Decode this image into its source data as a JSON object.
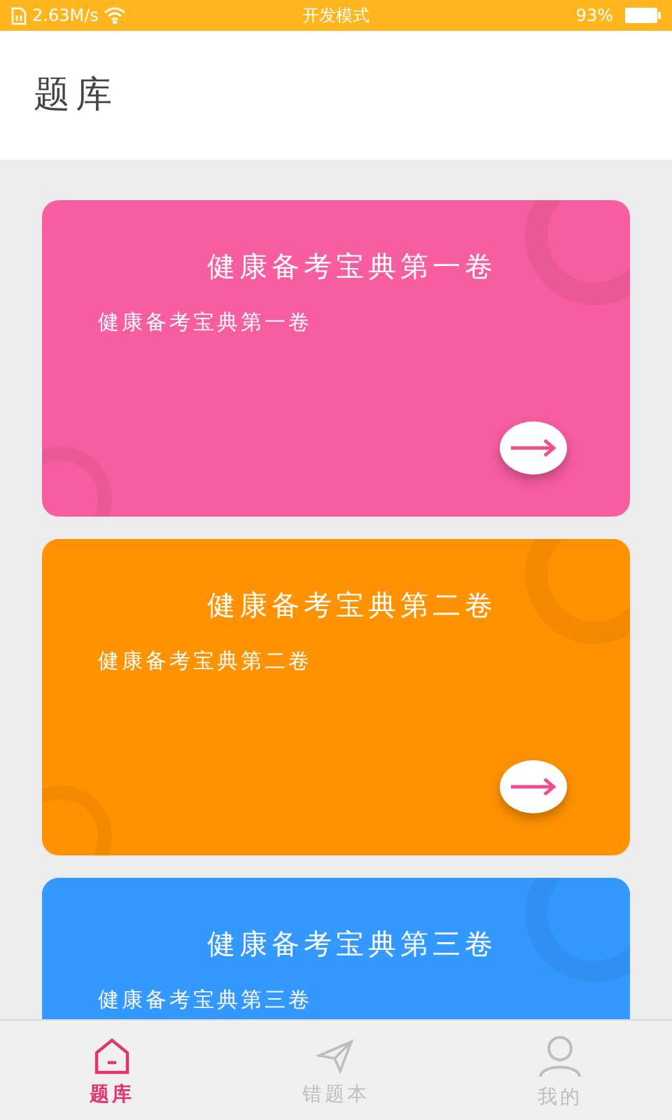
{
  "status_bar": {
    "speed": "2.63M/s",
    "mode": "开发模式",
    "battery": "93%"
  },
  "header": {
    "title": "题库"
  },
  "cards": [
    {
      "title": "健康备考宝典第一卷",
      "subtitle": "健康备考宝典第一卷",
      "color": "#f75d9f"
    },
    {
      "title": "健康备考宝典第二卷",
      "subtitle": "健康备考宝典第二卷",
      "color": "#ff9200"
    },
    {
      "title": "健康备考宝典第三卷",
      "subtitle": "健康备考宝典第三卷",
      "color": "#3399ff"
    }
  ],
  "tabs": [
    {
      "label": "题库",
      "kind": "home",
      "selected": true
    },
    {
      "label": "错题本",
      "kind": "send",
      "selected": false
    },
    {
      "label": "我的",
      "kind": "user",
      "selected": false
    }
  ]
}
